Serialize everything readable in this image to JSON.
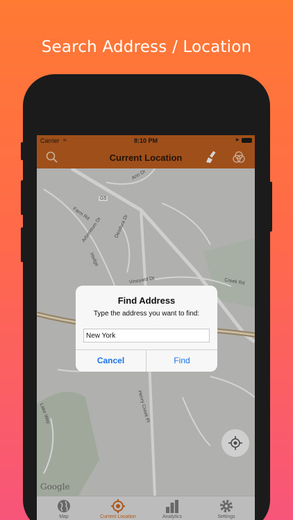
{
  "promo": {
    "headline": "Search Address / Location"
  },
  "status_bar": {
    "carrier": "Carrier",
    "time": "8:10 PM"
  },
  "nav_bar": {
    "title": "Current Location",
    "left_icon": "search-icon",
    "right_icons": [
      "brush-icon",
      "color-circles-icon"
    ]
  },
  "map": {
    "streets": [
      "Ann Dr",
      "G5",
      "Farm Rd",
      "Arboretum Dr",
      "Deodara Dr",
      "Hedge",
      "Vineyard Dr",
      "Creek Rd",
      "Henry Creek Pl",
      "Lake Way"
    ],
    "attribution": "Google"
  },
  "dialog": {
    "title": "Find Address",
    "message": "Type the address you want to find:",
    "input_value": "New York",
    "cancel_label": "Cancel",
    "find_label": "Find"
  },
  "tabs": [
    {
      "label": "Map",
      "icon": "globe-icon",
      "active": false
    },
    {
      "label": "Current Location",
      "icon": "crosshair-icon",
      "active": true
    },
    {
      "label": "Analytics",
      "icon": "bar-chart-icon",
      "active": false
    },
    {
      "label": "Settings",
      "icon": "gear-icon",
      "active": false
    }
  ],
  "colors": {
    "accent": "#b45a1e",
    "active_tab": "#c8641c",
    "link_blue": "#1a73e8"
  }
}
